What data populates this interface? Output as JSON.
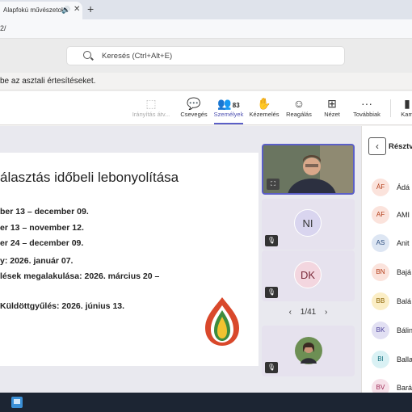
{
  "browser": {
    "tab_title": "Alapfokú művészetokt",
    "new_tab_label": "+",
    "close_label": "✕",
    "address": "2/"
  },
  "teams": {
    "search_placeholder": "Keresés (Ctrl+Alt+E)",
    "notification": "be az asztali értesítéseket."
  },
  "meeting_toolbar": {
    "control": "Irányítás átv...",
    "chat": "Csevegés",
    "people": "Személyek",
    "people_count": "83",
    "raise_hand": "Kézemelés",
    "react": "Reagálás",
    "view": "Nézet",
    "more": "Továbbiak",
    "camera": "Kam"
  },
  "slide": {
    "title": "álasztás időbeli lebonyolítása",
    "lines": [
      "ber 13 – december 09.",
      "er 13 – november 12.",
      "er 24 – december 09.",
      "y: 2026. január 07.",
      "lések megalakulása: 2026. március 20 –",
      "Küldöttgyűlés: 2026. június 13."
    ]
  },
  "tiles": [
    {
      "initials": "NI"
    },
    {
      "initials": "DK"
    }
  ],
  "pager": {
    "prev": "‹",
    "label": "1/41",
    "next": "›"
  },
  "participants_panel": {
    "title": "Résztve",
    "back": "‹",
    "people": [
      {
        "initials": "ÁF",
        "name": "Ádá",
        "color": "#fbe3dc",
        "text_color": "#b23c17"
      },
      {
        "initials": "AF",
        "name": "AMI",
        "color": "#fbe3dc",
        "text_color": "#b23c17"
      },
      {
        "initials": "AS",
        "name": "Anit",
        "color": "#dde6f3",
        "text_color": "#2b4c7e"
      },
      {
        "initials": "BN",
        "name": "Bajá",
        "color": "#fbe3dc",
        "text_color": "#b23c17"
      },
      {
        "initials": "BB",
        "name": "Balá",
        "color": "#fbeec6",
        "text_color": "#8a6200"
      },
      {
        "initials": "BK",
        "name": "Bálin",
        "color": "#e2e0f3",
        "text_color": "#4b3f9a"
      },
      {
        "initials": "BI",
        "name": "Balla",
        "color": "#d9f1f4",
        "text_color": "#136f7d"
      },
      {
        "initials": "BV",
        "name": "Bará",
        "color": "#f6e1e9",
        "text_color": "#9c2452"
      }
    ]
  }
}
